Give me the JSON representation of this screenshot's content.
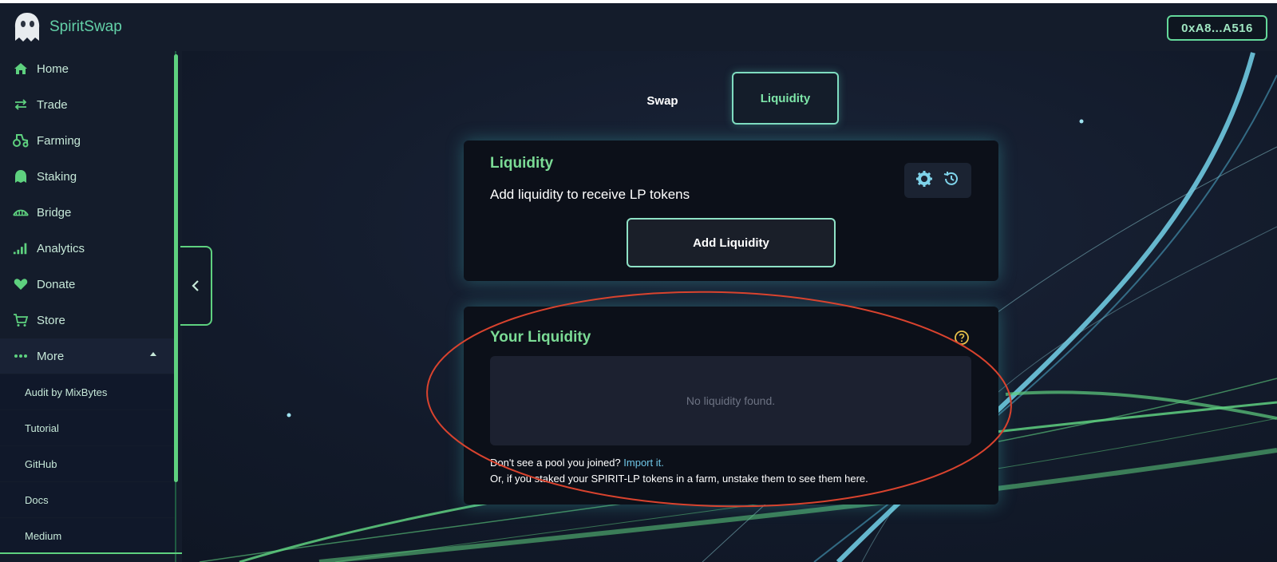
{
  "app": {
    "brand_name": "SpiritSwap"
  },
  "wallet": {
    "address": "0xA8...A516"
  },
  "sidebar": {
    "items": [
      {
        "label": "Home",
        "icon": "home-icon"
      },
      {
        "label": "Trade",
        "icon": "swap-arrows-icon"
      },
      {
        "label": "Farming",
        "icon": "tractor-icon"
      },
      {
        "label": "Staking",
        "icon": "ghost-icon"
      },
      {
        "label": "Bridge",
        "icon": "bridge-icon"
      },
      {
        "label": "Analytics",
        "icon": "bar-chart-icon"
      },
      {
        "label": "Donate",
        "icon": "heart-icon"
      },
      {
        "label": "Store",
        "icon": "cart-icon"
      },
      {
        "label": "More",
        "icon": "dots-icon"
      }
    ],
    "more_items": [
      "Audit by MixBytes",
      "Tutorial",
      "GitHub",
      "Docs",
      "Medium"
    ]
  },
  "tabs": {
    "swap": "Swap",
    "liquidity": "Liquidity"
  },
  "liquidity_card": {
    "title": "Liquidity",
    "description": "Add liquidity to receive LP tokens",
    "add_button": "Add Liquidity"
  },
  "your_liquidity": {
    "title": "Your Liquidity",
    "empty_message": "No liquidity found.",
    "note_line1": "Don't see a pool you joined?",
    "import_link": "Import it.",
    "note_line2": "Or, if you staked your SPIRIT-LP tokens in a farm, unstake them to see them here."
  },
  "colors": {
    "accent_green": "#5ed17f",
    "accent_teal": "#7fdcc0",
    "annotation_red": "#d9432e"
  }
}
